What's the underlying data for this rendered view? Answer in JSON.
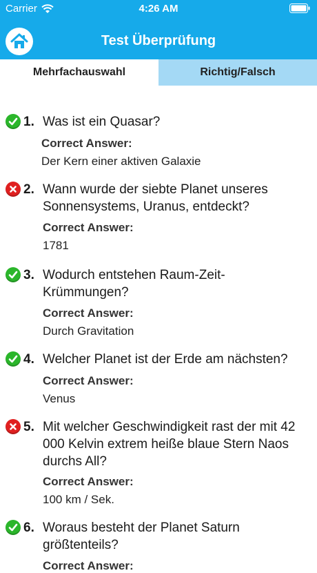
{
  "status_bar": {
    "carrier": "Carrier",
    "time": "4:26 AM"
  },
  "nav": {
    "title": "Test Überprüfung"
  },
  "tabs": [
    {
      "label": "Mehrfachauswahl",
      "active": true
    },
    {
      "label": "Richtig/Falsch",
      "active": false
    }
  ],
  "answer_label": "Correct Answer:",
  "questions": [
    {
      "number": "1.",
      "correct": true,
      "text": "Was ist ein Quasar?",
      "answer": "Der Kern einer aktiven Galaxie"
    },
    {
      "number": "2.",
      "correct": false,
      "text": "Wann wurde der siebte Planet unseres Sonnensystems, Uranus, entdeckt?",
      "answer": "1781"
    },
    {
      "number": "3.",
      "correct": true,
      "text": "Wodurch entstehen Raum-Zeit-Krümmungen?",
      "answer": "Durch Gravitation"
    },
    {
      "number": "4.",
      "correct": true,
      "text": "Welcher Planet ist der Erde am nächsten?",
      "answer": "Venus"
    },
    {
      "number": "5.",
      "correct": false,
      "text": "Mit welcher Geschwindigkeit rast der mit 42 000 Kelvin extrem heiße blaue Stern Naos durchs All?",
      "answer": "100 km / Sek."
    },
    {
      "number": "6.",
      "correct": true,
      "text": "Woraus besteht der Planet Saturn größtenteils?",
      "answer": ""
    }
  ],
  "colors": {
    "accent": "#16aaea",
    "tab_inactive": "#a4d9f5",
    "correct": "#2bb62b",
    "wrong": "#e02020"
  }
}
